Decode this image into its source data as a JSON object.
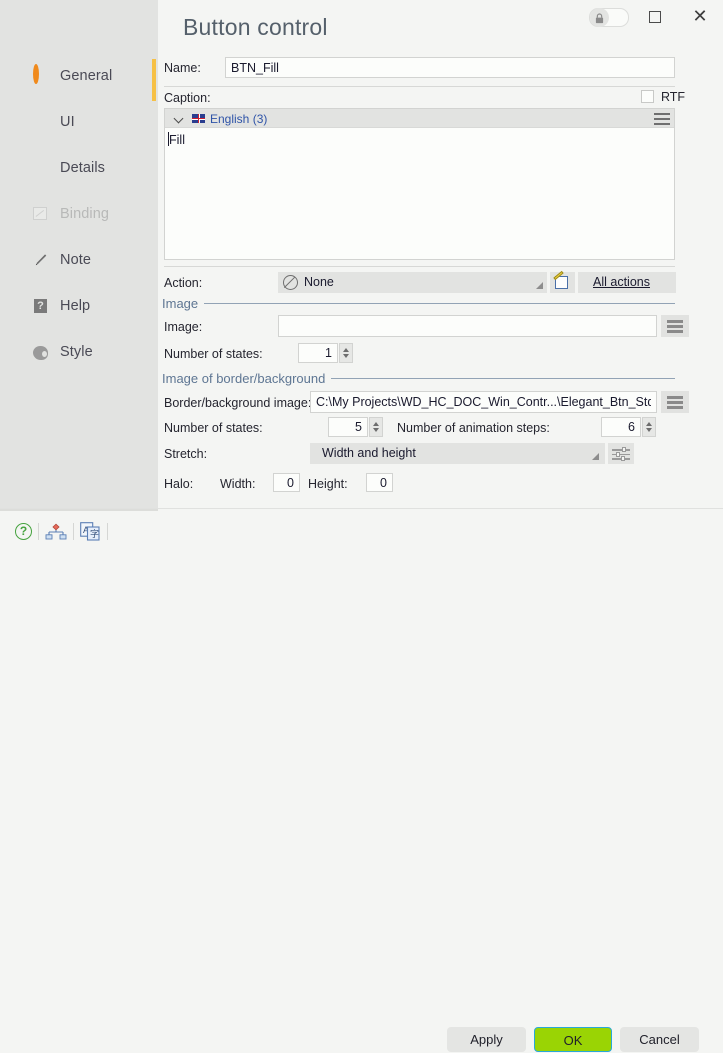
{
  "window": {
    "title": "Button control",
    "lock_icon": "lock-icon",
    "maximize_icon": "maximize-icon",
    "close_icon": "close-icon"
  },
  "sidebar": {
    "items": [
      {
        "label": "General",
        "icon": "orange-ring-icon",
        "active": true,
        "disabled": false
      },
      {
        "label": "UI",
        "icon": "eye-icon",
        "active": false,
        "disabled": false
      },
      {
        "label": "Details",
        "icon": "heart-circle-icon",
        "active": false,
        "disabled": false
      },
      {
        "label": "Binding",
        "icon": "binding-icon",
        "active": false,
        "disabled": true
      },
      {
        "label": "Note",
        "icon": "pencil-icon",
        "active": false,
        "disabled": false
      },
      {
        "label": "Help",
        "icon": "question-box-icon",
        "active": false,
        "disabled": false
      },
      {
        "label": "Style",
        "icon": "palette-icon",
        "active": false,
        "disabled": false
      }
    ],
    "accent_color": "#f6c045"
  },
  "form": {
    "name_label": "Name:",
    "name_value": "BTN_Fill",
    "caption_label": "Caption:",
    "rtf_label": "RTF",
    "rtf_checked": false,
    "caption_language": "English (3)",
    "caption_text": "Fill",
    "action_label": "Action:",
    "action_value": "None",
    "all_actions_label": "All actions",
    "image_section": "Image",
    "image_label": "Image:",
    "image_value": "",
    "image_states_label": "Number of states:",
    "image_states_value": "1",
    "border_section": "Image of border/background",
    "border_image_label": "Border/background image:",
    "border_image_value": "C:\\My Projects\\WD_HC_DOC_Win_Contr...\\Elegant_Btn_Std.png",
    "border_states_label": "Number of states:",
    "border_states_value": "5",
    "anim_steps_label": "Number of animation steps:",
    "anim_steps_value": "6",
    "stretch_label": "Stretch:",
    "stretch_value": "Width and height",
    "halo_label": "Halo:",
    "halo_width_label": "Width:",
    "halo_width_value": "0",
    "halo_height_label": "Height:",
    "halo_height_value": "0"
  },
  "footer": {
    "help_icon": "help-circle-icon",
    "tree_icon": "hierarchy-icon",
    "translate_icon": "translate-icon",
    "apply_label": "Apply",
    "ok_label": "OK",
    "cancel_label": "Cancel",
    "ok_color": "#9ad404"
  }
}
